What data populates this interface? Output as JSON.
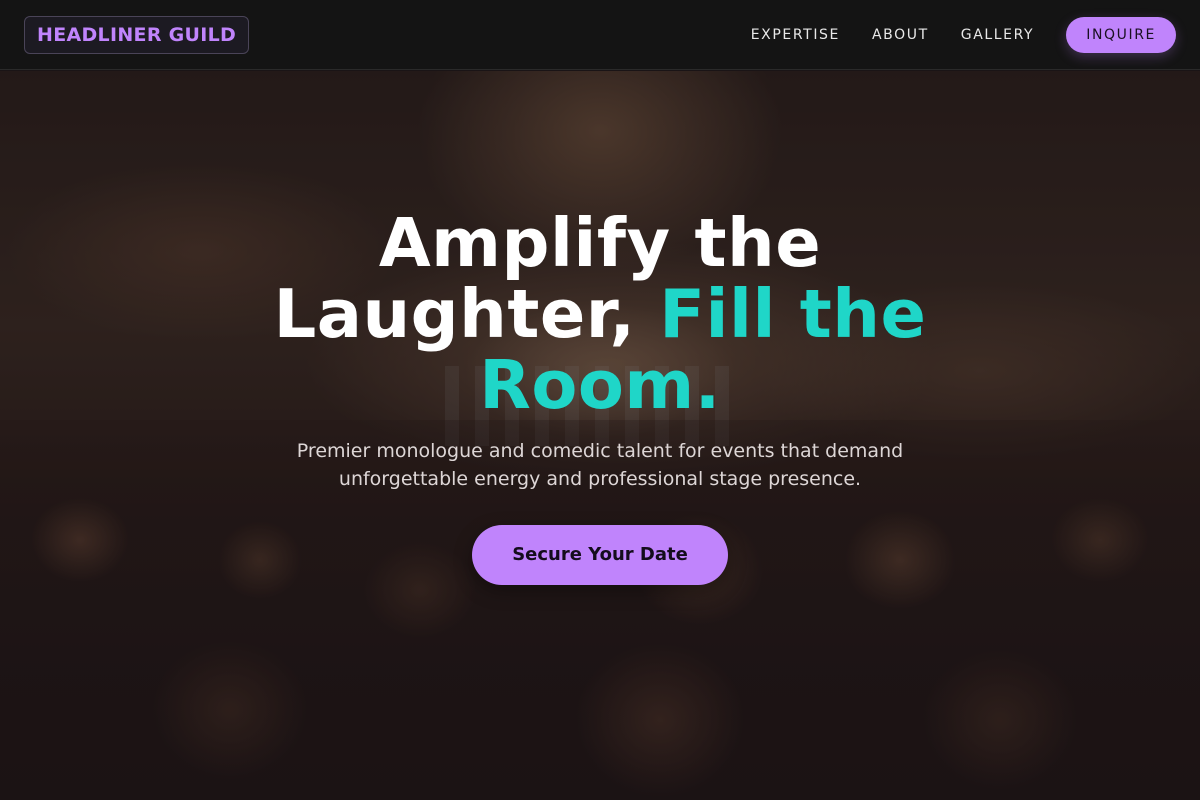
{
  "nav": {
    "logo": "HEADLINER GUILD",
    "links": [
      "EXPERTISE",
      "ABOUT",
      "GALLERY"
    ],
    "cta": "INQUIRE"
  },
  "hero": {
    "headline_part1": "Amplify the Laughter, ",
    "headline_accent": "Fill the Room.",
    "subtext": "Premier monologue and comedic talent for events that demand unforgettable energy and professional stage presence.",
    "cta": "Secure Your Date"
  },
  "colors": {
    "accent_purple": "#c084fc",
    "accent_teal": "#1fd6c8",
    "nav_bg": "#141414"
  },
  "background_image": "concert-crowd-photo"
}
